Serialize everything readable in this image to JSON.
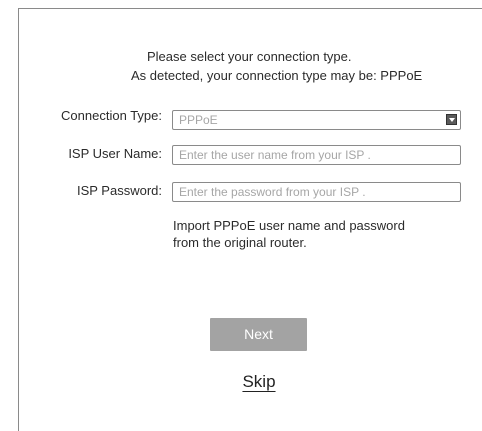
{
  "intro": {
    "line1": "Please select your connection type.",
    "line2": "As detected, your connection type may be: PPPoE"
  },
  "form": {
    "connection_type": {
      "label": "Connection Type:",
      "value": "PPPoE",
      "icon": "dropdown-arrow-icon"
    },
    "isp_user_name": {
      "label": "ISP User Name:",
      "placeholder": "Enter the user name from your ISP ."
    },
    "isp_password": {
      "label": "ISP Password:",
      "placeholder": "Enter the password from your ISP ."
    }
  },
  "import_note": {
    "line1": "Import PPPoE user name and password",
    "line2": "from the original router."
  },
  "buttons": {
    "next": "Next",
    "skip": "Skip"
  },
  "colors": {
    "next_button_bg": "#a3a3a3",
    "border": "#8a8a8a",
    "placeholder_text": "#a6a6a6"
  }
}
